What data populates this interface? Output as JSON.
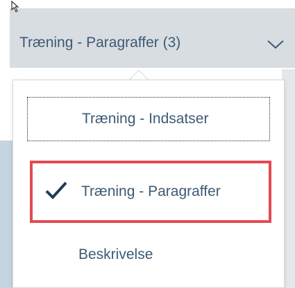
{
  "header": {
    "label": "Træning - Paragraffer (3)"
  },
  "menu": {
    "items": [
      {
        "label": "Træning - Indsatser"
      },
      {
        "label": "Træning - Paragraffer"
      },
      {
        "label": "Beskrivelse"
      }
    ]
  },
  "colors": {
    "text": "#3d5a74",
    "header_bg": "#d8dde1",
    "highlight_border": "#e24b52",
    "check": "#1f3a5a"
  },
  "icons": [
    "cursor-icon",
    "chevron-down-icon",
    "checkmark-icon"
  ]
}
